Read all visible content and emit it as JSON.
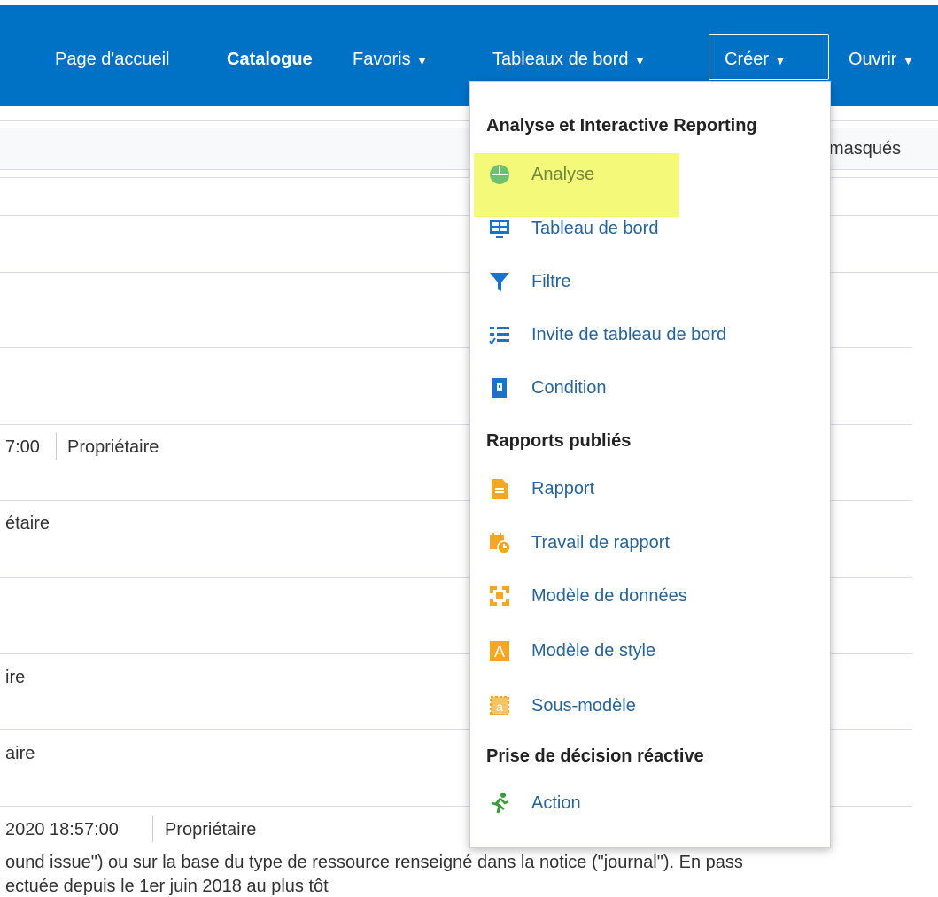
{
  "nav": {
    "home": "Page d'accueil",
    "catalogue": "Catalogue",
    "favoris": "Favoris",
    "tableaux": "Tableaux de bord",
    "creer": "Créer",
    "ouvrir": "Ouvrir",
    "caret": "▼"
  },
  "background": {
    "masques": "masqués",
    "row1_time": "7:00",
    "row1_owner": "Propriétaire",
    "row2": "étaire",
    "row3": "ire",
    "row4": "aire",
    "row5_time": "2020 18:57:00",
    "row5_owner": "Propriétaire",
    "desc1": "ound issue\") ou sur la base du type de ressource renseigné dans la notice (\"journal\"). En pass",
    "desc2": "ectuée depuis le 1er juin 2018 au plus tôt"
  },
  "menu": {
    "section1": "Analyse et Interactive Reporting",
    "section2": "Rapports publiés",
    "section3": "Prise de décision réactive",
    "items": [
      {
        "label": "Analyse",
        "icon": "analysis-icon"
      },
      {
        "label": "Tableau de bord",
        "icon": "dashboard-icon"
      },
      {
        "label": "Filtre",
        "icon": "filter-icon"
      },
      {
        "label": "Invite de tableau de bord",
        "icon": "prompt-list-icon"
      },
      {
        "label": "Condition",
        "icon": "condition-icon"
      },
      {
        "label": "Rapport",
        "icon": "report-icon"
      },
      {
        "label": "Travail de rapport",
        "icon": "report-job-icon"
      },
      {
        "label": "Modèle de données",
        "icon": "data-model-icon"
      },
      {
        "label": "Modèle de style",
        "icon": "style-template-icon"
      },
      {
        "label": "Sous-modèle",
        "icon": "sub-template-icon"
      },
      {
        "label": "Action",
        "icon": "action-icon"
      }
    ]
  },
  "colors": {
    "brand": "#0072c6",
    "highlight": "#f4f97a",
    "link": "#2a6496",
    "orange": "#f5a623",
    "blue_icon": "#1a73c8",
    "green": "#5cb85c"
  }
}
